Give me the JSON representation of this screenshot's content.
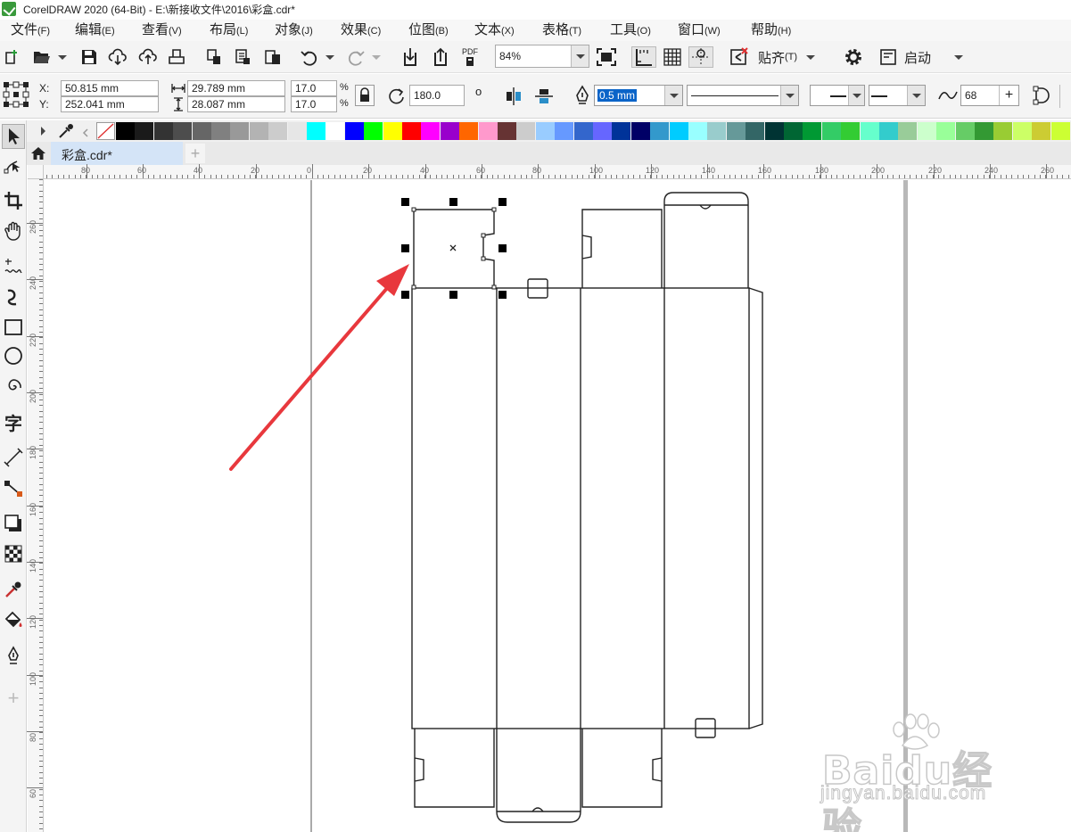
{
  "window": {
    "title": "CorelDRAW 2020 (64-Bit) - E:\\新接收文件\\2016\\彩盒.cdr*"
  },
  "menu": [
    {
      "label": "文件",
      "key": "(F)"
    },
    {
      "label": "编辑",
      "key": "(E)"
    },
    {
      "label": "查看",
      "key": "(V)"
    },
    {
      "label": "布局",
      "key": "(L)"
    },
    {
      "label": "对象",
      "key": "(J)"
    },
    {
      "label": "效果",
      "key": "(C)"
    },
    {
      "label": "位图",
      "key": "(B)"
    },
    {
      "label": "文本",
      "key": "(X)"
    },
    {
      "label": "表格",
      "key": "(T)"
    },
    {
      "label": "工具",
      "key": "(O)"
    },
    {
      "label": "窗口",
      "key": "(W)"
    },
    {
      "label": "帮助",
      "key": "(H)"
    }
  ],
  "toolbar": {
    "zoom": "84%",
    "snap_label": "贴齐",
    "snap_key": "(T)",
    "launch_label": "启动",
    "pdf_label": "PDF"
  },
  "property_bar": {
    "x_label": "X:",
    "y_label": "Y:",
    "x_value": "50.815 mm",
    "y_value": "252.041 mm",
    "width_value": "29.789 mm",
    "height_value": "28.087 mm",
    "scale_x": "17.0",
    "scale_y": "17.0",
    "percent_x": "%",
    "percent_y": "%",
    "rotation": "180.0",
    "degree_symbol": "o",
    "outline_width": "0.5 mm",
    "curve_smoothness": "68"
  },
  "palette": [
    "#000000",
    "#1a1a1a",
    "#333333",
    "#4d4d4d",
    "#666666",
    "#808080",
    "#999999",
    "#b3b3b3",
    "#cccccc",
    "#e6e6e6",
    "#00ffff",
    "#ffffff",
    "#0000ff",
    "#00ff00",
    "#ffff00",
    "#ff0000",
    "#ff00ff",
    "#9900cc",
    "#ff6600",
    "#ff99cc",
    "#663333",
    "#cccccc",
    "#99ccff",
    "#6699ff",
    "#3366cc",
    "#6666ff",
    "#003399",
    "#000066",
    "#3399cc",
    "#00ccff",
    "#99ffff",
    "#99cccc",
    "#669999",
    "#336666",
    "#003333",
    "#006633",
    "#009933",
    "#33cc66",
    "#33cc33",
    "#66ffcc",
    "#33cccc",
    "#99cc99",
    "#ccffcc",
    "#99ff99",
    "#66cc66",
    "#339933",
    "#99cc33",
    "#ccff66",
    "#cccc33",
    "#ccff33"
  ],
  "document": {
    "tab_label": "彩盒.cdr*"
  },
  "rulers": {
    "horizontal_labels": [
      "80",
      "60",
      "40",
      "20",
      "0",
      "20",
      "40",
      "60",
      "80",
      "100",
      "120",
      "140",
      "160",
      "180",
      "200",
      "220",
      "240",
      "260"
    ],
    "vertical_labels": [
      "260",
      "240",
      "220",
      "200",
      "180",
      "160",
      "140",
      "120",
      "100",
      "80",
      "60"
    ]
  },
  "watermark": {
    "brand": "Baidu经验",
    "url": "jingyan.baidu.com"
  },
  "colors": {
    "accent_red": "#e8383d",
    "selection_tab": "#d4e4f7",
    "outline_highlight": "#0a64c8"
  }
}
